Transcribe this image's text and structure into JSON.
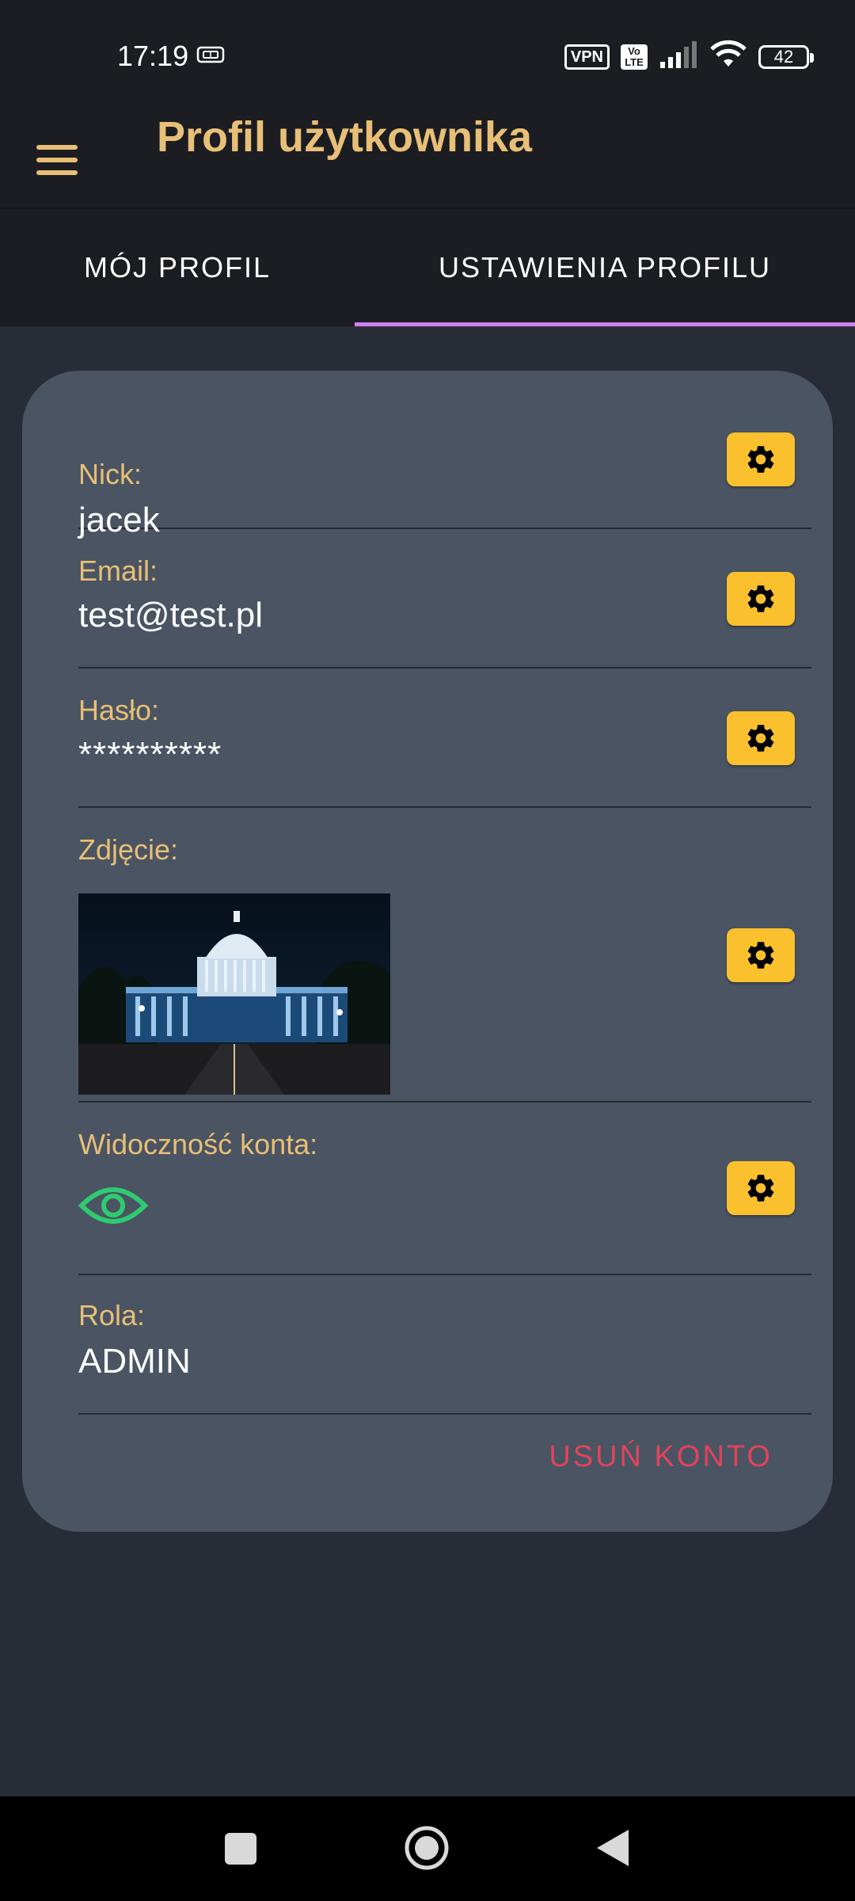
{
  "status_bar": {
    "time": "17:19",
    "vpn": "VPN",
    "volte": "Vo\nLTE",
    "battery": "42"
  },
  "app_bar": {
    "title": "Profil użytkownika"
  },
  "tabs": [
    {
      "label": "MÓJ PROFIL",
      "selected": false
    },
    {
      "label": "USTAWIENIA PROFILU",
      "selected": true
    }
  ],
  "profile": {
    "nick": {
      "label": "Nick:",
      "value": "jacek"
    },
    "email": {
      "label": "Email:",
      "value": "test@test.pl"
    },
    "password": {
      "label": "Hasło:",
      "value": "**********"
    },
    "photo": {
      "label": "Zdjęcie:"
    },
    "visibility": {
      "label": "Widoczność konta:",
      "icon": "eye-icon",
      "visible": true
    },
    "role": {
      "label": "Rola:",
      "value": "ADMIN"
    }
  },
  "actions": {
    "delete_account": "USUŃ KONTO"
  },
  "colors": {
    "accent": "#e8bf77",
    "tab_indicator": "#cf7ff2",
    "settings_button": "#fbc02d",
    "danger": "#e0445b",
    "eye_icon": "#2ecc71",
    "card_bg": "#4a5462"
  }
}
